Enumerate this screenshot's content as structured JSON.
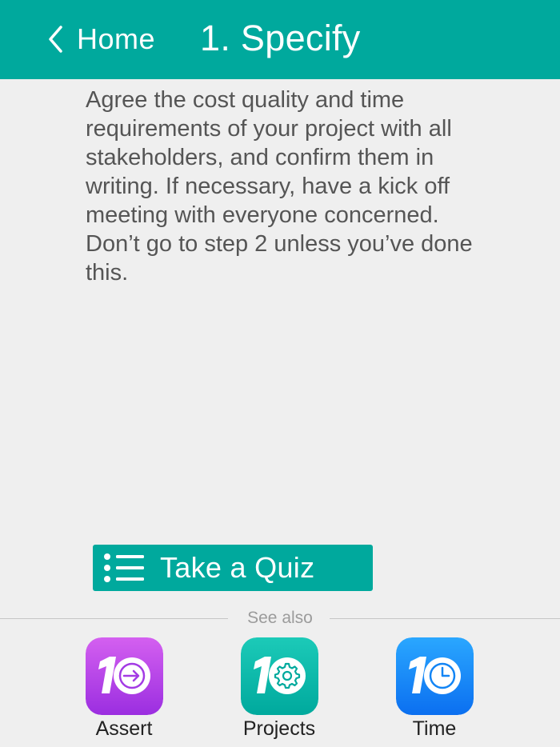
{
  "header": {
    "back_label": "Home",
    "title": "1. Specify",
    "color": "#00a99d"
  },
  "content": {
    "body_text": "Agree the cost quality and time requirements of your project with all stakeholders, and confirm them in writing.  If necessary, have a kick off meeting with everyone concerned.  Don’t go to step 2 unless you’ve done this."
  },
  "quiz_button": {
    "label": "Take a Quiz",
    "icon": "list-icon"
  },
  "see_also": {
    "label": "See also",
    "apps": [
      {
        "label": "Assert",
        "icon": "assert-app-icon",
        "colors": [
          "#d460f0",
          "#9b2ee0"
        ]
      },
      {
        "label": "Projects",
        "icon": "projects-app-icon",
        "colors": [
          "#1ccab8",
          "#00a99d"
        ]
      },
      {
        "label": "Time",
        "icon": "time-app-icon",
        "colors": [
          "#2aa7ff",
          "#0b6ff0"
        ]
      }
    ]
  }
}
